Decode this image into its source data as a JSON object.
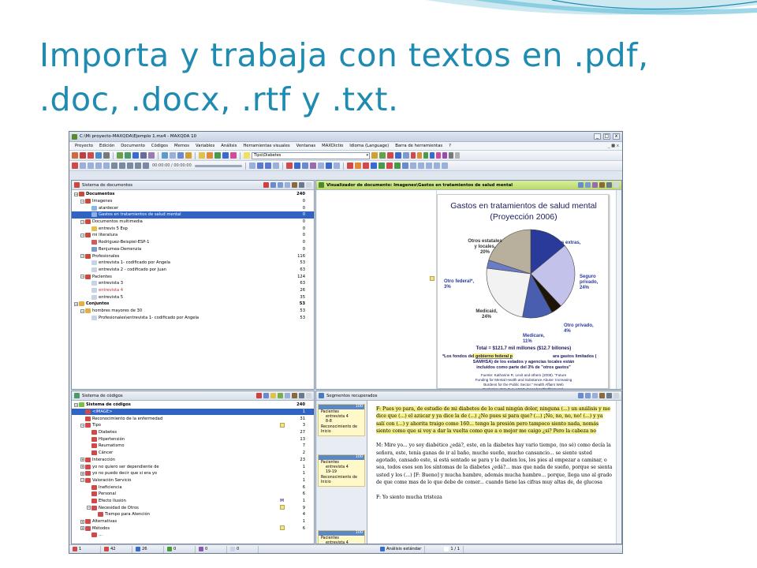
{
  "slide": {
    "title_line1": "Importa y trabaja con textos en .pdf,",
    "title_line2": ".doc, .docx, .rtf y .txt."
  },
  "window": {
    "title": "C:\\Mi proyecto-MAXQDA\\Ejemplo 1.mx4 - MAXQDA 10",
    "controls": [
      "_",
      "□",
      "x"
    ]
  },
  "menu": {
    "items": [
      "Proyecto",
      "Edición",
      "Documento",
      "Códigos",
      "Memos",
      "Variables",
      "Análisis",
      "Herramientas visuales",
      "Ventanas",
      "MAXDictio",
      "Idioma (Language)",
      "Barra de herramientas",
      "?"
    ],
    "right": "_ ■ x"
  },
  "toolbar": {
    "code_combo": "Tipo\\Diabetes",
    "time_display": "00:00:00 / 00:00:00"
  },
  "documents": {
    "header": "Sistema de documentos",
    "rows": [
      {
        "label": "Documentos",
        "num": "240",
        "level": 0,
        "bold": true,
        "tog": "-",
        "icon": "#c94a3a"
      },
      {
        "label": "Imagenes",
        "num": "0",
        "level": 1,
        "tog": "-",
        "icon": "#c94a3a"
      },
      {
        "label": "atardecer",
        "num": "0",
        "level": 2,
        "icon": "#8ab4e6"
      },
      {
        "label": "Gastos en tratamientos de salud mental",
        "num": "0",
        "level": 2,
        "sel": true,
        "icon": "#8ab4e6"
      },
      {
        "label": "Documentos multimedia",
        "num": "0",
        "level": 1,
        "tog": "-",
        "icon": "#c94a3a"
      },
      {
        "label": "entrevis 5 Esp",
        "num": "0",
        "level": 2,
        "icon": "#e0c24a"
      },
      {
        "label": "mi literatura",
        "num": "0",
        "level": 1,
        "tog": "-",
        "icon": "#c94a3a"
      },
      {
        "label": "Rodriguez-Beispiel-ESP-1",
        "num": "0",
        "level": 2,
        "icon": "#d35a5a"
      },
      {
        "label": "Benjumea-Demenzia",
        "num": "0",
        "level": 2,
        "icon": "#7a9ad0"
      },
      {
        "label": "Profesionales",
        "num": "116",
        "level": 1,
        "tog": "-",
        "icon": "#c94a3a"
      },
      {
        "label": "entrevista 1- codificado por Angela",
        "num": "53",
        "level": 2,
        "icon": "#c8d4e6"
      },
      {
        "label": "entrevista 2 - codificado por Juan",
        "num": "63",
        "level": 2,
        "icon": "#c8d4e6"
      },
      {
        "label": "Pacientes",
        "num": "124",
        "level": 1,
        "tog": "-",
        "icon": "#c94a3a"
      },
      {
        "label": "entrevista 3",
        "num": "63",
        "level": 2,
        "icon": "#c8d4e6"
      },
      {
        "label": "entrevista 4",
        "num": "26",
        "level": 2,
        "red": true,
        "icon": "#c8d4e6"
      },
      {
        "label": "entrevista 5",
        "num": "35",
        "level": 2,
        "icon": "#c8d4e6"
      },
      {
        "label": "Conjuntos",
        "num": "53",
        "level": 0,
        "bold": true,
        "tog": "-",
        "icon": "#e0b040"
      },
      {
        "label": "hombres mayores de 30",
        "num": "53",
        "level": 1,
        "tog": "-",
        "icon": "#e0b040"
      },
      {
        "label": "Profesionales\\entrevista 1- codificado por Angela",
        "num": "53",
        "level": 2,
        "icon": "#c8d4e6"
      }
    ]
  },
  "viewer": {
    "header": "Visualizador de documento: Imagenes\\Gastos en tratamientos de salud mental"
  },
  "chart_data": {
    "type": "pie",
    "title": "Gastos en tratamientos de salud mental",
    "subtitle": "(Proyección 2006)",
    "slices": [
      {
        "label": "Gastos extras,",
        "pct": 14,
        "pct_label": "14%",
        "color": "#2a3a9a"
      },
      {
        "label": "Seguro privado,",
        "pct": 24,
        "pct_label": "24%",
        "color": "#c2c2ea"
      },
      {
        "label": "Otro privado,",
        "pct": 4,
        "pct_label": "4%",
        "color": "#1e1408"
      },
      {
        "label": "Medicare,",
        "pct": 11,
        "pct_label": "11%",
        "color": "#4a5eb0"
      },
      {
        "label": "Medicaid,",
        "pct": 24,
        "pct_label": "24%",
        "color": "#f2f2f2"
      },
      {
        "label": "Otro federal*,",
        "pct": 3,
        "pct_label": "3%",
        "color": "#6a7cc8"
      },
      {
        "label": "Otros estatales y locales,",
        "pct": 20,
        "pct_label": "20%",
        "color": "#b8b09c"
      }
    ],
    "total": "Total = $121.7 mil millones ($12.7 billones)",
    "footnote_pre": "*Los fondos del ",
    "footnote_hl": "gobierno federal p",
    "footnote_post": "ara gastos limitados (SAMHSA) de los estados y agencias locales están incluidos como parte del 3% de \"otros gastos\"",
    "source": "Fuente: Katharine R. Levit and others (2008). \"Future Funding for Mental Health and Substance Abuse: Increasing Burdens for the Public Sector.\" Health Affairs Web Exclusive, Oct. 7, p. w517. (www.healthaffairs.org)."
  },
  "codes": {
    "header": "Sistema de códigos",
    "rows": [
      {
        "label": "Sistema de códigos",
        "num": "240",
        "level": 0,
        "bold": true,
        "tog": "-",
        "icon": "#7bbf4a"
      },
      {
        "label": "<IMAGE>",
        "num": "1",
        "level": 1,
        "sel": true,
        "icon": "#d04a4a"
      },
      {
        "label": "Reconocimiento de la enfermedad",
        "num": "31",
        "level": 1,
        "icon": "#d04a4a"
      },
      {
        "label": "Tipo",
        "num": "3",
        "level": 1,
        "tog": "-",
        "icon": "#d04a4a",
        "memo": true
      },
      {
        "label": "Diabetes",
        "num": "27",
        "level": 2,
        "icon": "#d04a4a"
      },
      {
        "label": "Hipertensión",
        "num": "13",
        "level": 2,
        "icon": "#d04a4a"
      },
      {
        "label": "Reumatismo",
        "num": "7",
        "level": 2,
        "icon": "#d04a4a"
      },
      {
        "label": "Cáncer",
        "num": "2",
        "level": 2,
        "icon": "#d04a4a"
      },
      {
        "label": "Interacción",
        "num": "23",
        "level": 1,
        "tog": "+",
        "icon": "#d04a4a"
      },
      {
        "label": "yo no quiero ser dependiente de",
        "num": "1",
        "level": 1,
        "tog": "+",
        "icon": "#d04a4a"
      },
      {
        "label": "yo no puedo decir que si era yo",
        "num": "1",
        "level": 1,
        "tog": "+",
        "icon": "#d04a4a"
      },
      {
        "label": "Valoración Servicio",
        "num": "1",
        "level": 1,
        "tog": "-",
        "icon": "#d04a4a"
      },
      {
        "label": "Ineficiencia",
        "num": "6",
        "level": 2,
        "icon": "#d04a4a"
      },
      {
        "label": "Personal",
        "num": "6",
        "level": 2,
        "icon": "#d04a4a"
      },
      {
        "label": "Efecto Ilusión",
        "num": "1",
        "level": 2,
        "icon": "#d04a4a",
        "mflag": "M"
      },
      {
        "label": "Necesidad de Otros",
        "num": "9",
        "level": 2,
        "tog": "-",
        "icon": "#d04a4a",
        "memo": true
      },
      {
        "label": "Tiempo para Atención",
        "num": "4",
        "level": 3,
        "icon": "#d04a4a"
      },
      {
        "label": "Alternativas",
        "num": "1",
        "level": 1,
        "tog": "+",
        "icon": "#d04a4a"
      },
      {
        "label": "Métodos",
        "num": "6",
        "level": 1,
        "tog": "+",
        "icon": "#d04a4a",
        "memo": true
      },
      {
        "label": "...",
        "num": "",
        "level": 2,
        "icon": "#d04a4a"
      }
    ]
  },
  "segments": {
    "header": "Segmentos recuperados",
    "boxes": [
      {
        "n": "100",
        "lines": [
          "Pacientes",
          "entrevista 4",
          "8-8",
          "Reconocimiento de",
          "Inicio"
        ]
      },
      {
        "n": "100",
        "lines": [
          "Pacientes",
          "entrevista 4",
          "19-19",
          "Reconocimiento de",
          "Inicio"
        ]
      },
      {
        "n": "100",
        "lines": [
          "Pacientes",
          "entrevista 4"
        ]
      }
    ],
    "text_p1": "F: Pues yo para, de estudio de mi diabetes de lo cual ningún dolor, ninguna (...) un análisis y me dice que (...) el azúcar y ya dice la de (...) ¿No pues si para que? (...) ¡No, no, no, no! (...) y ya salí con (...) y ahorita traigo como 160... tengo la presión pero tampoco siento nada, nomás siento como que si voy a dar la vuelta como que a o mejor me caigo ¿si? Pero la cabeza no",
    "text_p2": "M: Mire yo... yo soy diabético ¿edá?, este, en la diabetes hay vario tiempo, (no sé) como decía la señora, este, tenía ganas de ir al baño, mucho sueño, mucho cansancio... se siente usted agotado, cansado este, si está sentado se para y le duelen los, los pies al empezar a caminar, o sea, todos esos son los síntomas de la diabetes ¿edá?... mas que nada de sueño, porque se sienta usted y los (...) [F: Bueno] y mucha hambre, además mucha hambre... porque, llega uno al grado de que come mas de lo que debe de comer... cuando tiene las cifras muy altas de, de glucosa",
    "text_p3": "F: Yo siento mucha tristeza"
  },
  "status": {
    "items": [
      {
        "text": "1",
        "color": "#d04a4a"
      },
      {
        "text": "42",
        "color": "#d04a4a"
      },
      {
        "text": "26",
        "color": "#3a6ad0"
      },
      {
        "text": "0",
        "color": "#4a9a3a"
      },
      {
        "text": "0",
        "color": "#8a5ab0"
      },
      {
        "text": "0",
        "color": "#c8d4e6"
      },
      {
        "text": "Análisis estándar",
        "color": "#3a6ad0"
      },
      {
        "text": "1 / 1",
        "color": "#ffffff"
      }
    ]
  },
  "colors": {
    "title": "#1f8bb0",
    "selection": "#3163c5"
  }
}
